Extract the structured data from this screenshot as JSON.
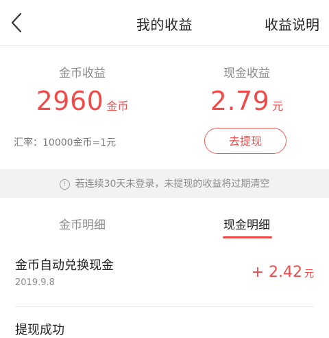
{
  "header": {
    "title": "我的收益",
    "explain_label": "收益说明"
  },
  "summary": {
    "coin": {
      "label": "金币收益",
      "value": "2960",
      "unit": "金币"
    },
    "cash": {
      "label": "现金收益",
      "value": "2.79",
      "unit": "元"
    },
    "rate_text": "汇率：10000金币=1元",
    "withdraw_label": "去提现"
  },
  "notice": {
    "icon": "info-icon",
    "text": "若连续30天未登录，未提现的收益将过期清空"
  },
  "tabs": [
    {
      "label": "金币明细",
      "active": false
    },
    {
      "label": "现金明细",
      "active": true
    }
  ],
  "records": [
    {
      "title": "金币自动兑换现金",
      "date": "2019.9.8",
      "amount": "+ 2.42",
      "unit": "元"
    },
    {
      "title": "提现成功"
    }
  ],
  "colors": {
    "accent": "#ee4b4b",
    "notice_bg": "#f2f2f2",
    "muted": "#8a8a8a"
  }
}
